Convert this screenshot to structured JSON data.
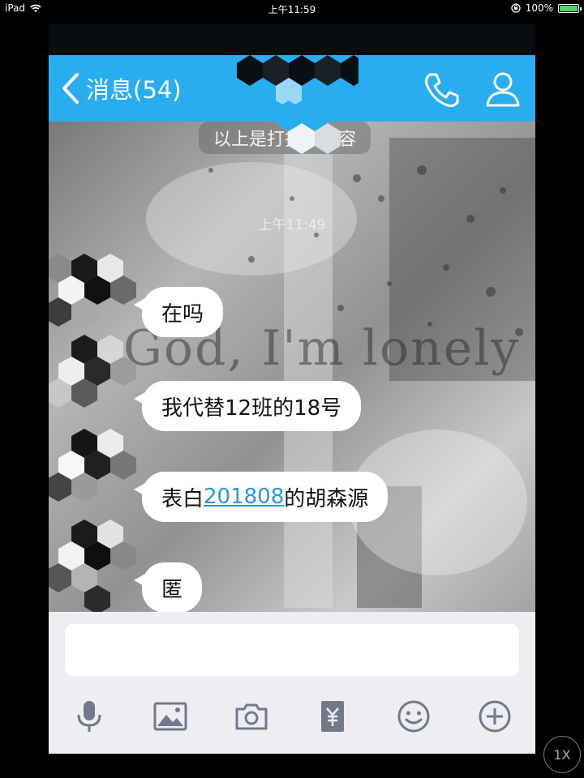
{
  "device_status": {
    "device": "iPad",
    "time": "上午11:59",
    "battery": "100%",
    "battery_level": 1.0
  },
  "navbar": {
    "back_title": "消息(54)",
    "color": "#27adf0"
  },
  "chat": {
    "notice": "以上是打招呼内容",
    "timestamp": "上午11:49",
    "watermark": "God, I'm lonely",
    "messages": [
      {
        "text": "在吗"
      },
      {
        "text": "我代替12班的18号"
      },
      {
        "prefix": "表白",
        "link": "201808",
        "suffix": "的胡森源"
      },
      {
        "text": "匿"
      }
    ]
  },
  "input": {
    "value": "",
    "placeholder": ""
  },
  "toolbar": {
    "icons": [
      "microphone-icon",
      "image-icon",
      "camera-icon",
      "red-packet-icon",
      "emoji-icon",
      "plus-icon"
    ]
  },
  "zoom": {
    "label": "1X"
  }
}
